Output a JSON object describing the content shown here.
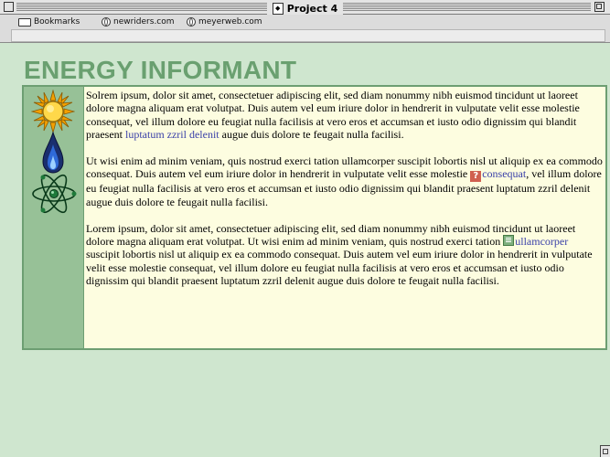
{
  "window": {
    "title": "Project 4"
  },
  "toolbar": {
    "bookmarks": "Bookmarks",
    "link1": "newriders.com",
    "link2": "meyerweb.com"
  },
  "page": {
    "heading": "ENERGY INFORMANT",
    "sidebar_icons": [
      "sun-icon",
      "flame-icon",
      "atom-icon"
    ],
    "paragraphs": [
      {
        "before": "Solrem ipsum, dolor sit amet, consectetuer adipiscing elit, sed diam nonummy nibh euismod tincidunt ut laoreet dolore magna aliquam erat volutpat. Duis autem vel eum iriure dolor in hendrerit in vulputate velit esse molestie consequat, vel illum dolore eu feugiat nulla facilisis at vero eros et accumsan et iusto odio dignissim qui blandit praesent ",
        "link": "luptatum zzril delenit",
        "after": " augue duis dolore te feugait nulla facilisi."
      },
      {
        "before": "Ut wisi enim ad minim veniam, quis nostrud exerci tation ullamcorper suscipit lobortis nisl ut aliquip ex ea commodo consequat. Duis autem vel eum iriure dolor in hendrerit in vulputate velit esse molestie ",
        "link": "consequat",
        "after": ", vel illum dolore eu feugiat nulla facilisis at vero eros et accumsan et iusto odio dignissim qui blandit praesent luptatum zzril delenit augue duis dolore te feugait nulla facilisi.",
        "link_icon": "help-icon"
      },
      {
        "before": "Lorem ipsum, dolor sit amet, consectetuer adipiscing elit, sed diam nonummy nibh euismod tincidunt ut laoreet dolore magna aliquam erat volutpat. Ut wisi enim ad minim veniam, quis nostrud exerci tation ",
        "link": "ullamcorper",
        "after": " suscipit lobortis nisl ut aliquip ex ea commodo consequat. Duis autem vel eum iriure dolor in hendrerit in vulputate velit esse molestie consequat, vel illum dolore eu feugiat nulla facilisis at vero eros et accumsan et iusto odio dignissim qui blandit praesent luptatum zzril delenit augue duis dolore te feugait nulla facilisi.",
        "link_icon": "document-icon"
      }
    ]
  },
  "colors": {
    "page_bg": "#cfe6cf",
    "heading": "#6aa070",
    "content_bg": "#fdfde0",
    "sidebar": "#97c197",
    "link": "#3a40a8"
  }
}
